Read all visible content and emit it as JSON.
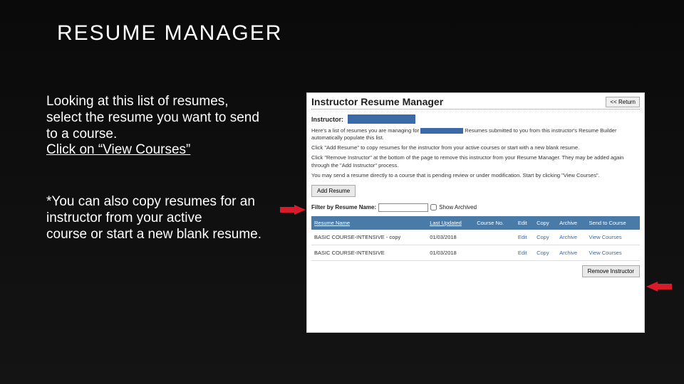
{
  "slide": {
    "title": "RESUME MANAGER",
    "para1_a": "Looking at this list of resumes, select the resume you want to send to a course.",
    "para1_b": "Click on “View Courses”",
    "para2_a": "*You can also copy resumes for an instructor from your active",
    "para2_b": "course or start a new blank resume."
  },
  "app": {
    "title": "Instructor Resume Manager",
    "return_btn": "<< Return",
    "instructor_label": "Instructor:",
    "blurb1_a": "Here's a list of resumes you are managing for",
    "blurb1_b": "Resumes submitted to you from this instructor's Resume Builder automatically populate this list.",
    "blurb2": "Click \"Add Resume\" to copy resumes for the instructor from your active courses or start with a new blank resume.",
    "blurb3": "Click \"Remove Instructor\" at the bottom of the page to remove this instructor from your Resume Manager. They may be added again through the \"Add Instructor\" process.",
    "blurb4": "You may send a resume directly to a course that is pending review or under modification. Start by clicking \"View Courses\".",
    "add_resume_btn": "Add Resume",
    "filter_label": "Filter by Resume Name:",
    "show_archived_label": "Show Archived",
    "remove_btn": "Remove Instructor",
    "filter_value": "",
    "columns": {
      "name": "Resume Name",
      "updated": "Last Updated",
      "course_no": "Course No.",
      "edit": "Edit",
      "copy": "Copy",
      "archive": "Archive",
      "send": "Send to Course"
    },
    "rows": [
      {
        "name": "BASIC COURSE-INTENSIVE - copy",
        "updated": "01/03/2018",
        "course_no": "",
        "edit": "Edit",
        "copy": "Copy",
        "archive": "Archive",
        "send": "View Courses"
      },
      {
        "name": "BASIC COURSE-INTENSIVE",
        "updated": "01/03/2018",
        "course_no": "",
        "edit": "Edit",
        "copy": "Copy",
        "archive": "Archive",
        "send": "View Courses"
      }
    ]
  },
  "colors": {
    "arrow": "#d81b2a"
  }
}
